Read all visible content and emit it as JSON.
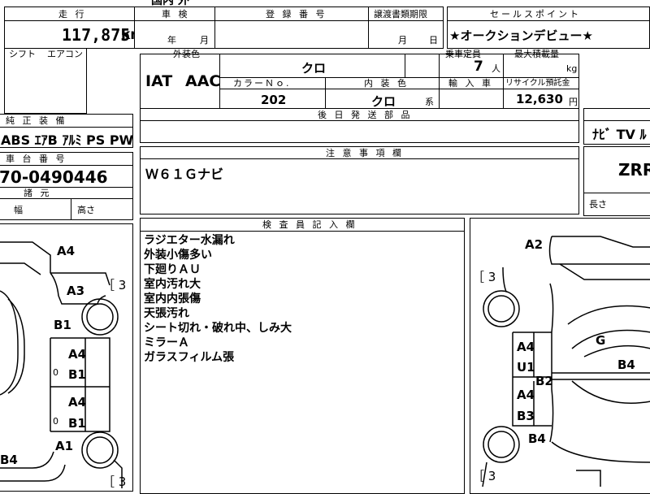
{
  "header": {
    "top_cut_text": "国内 外",
    "mileage_label": "走 行",
    "mileage_value": "117,875",
    "mileage_unit": "km",
    "shaken_label": "車 検",
    "shaken_year_unit": "年",
    "shaken_month_unit": "月",
    "reg_label": "登 録 番 号",
    "transfer_label": "譲渡書類期限",
    "transfer_month_unit": "月",
    "transfer_day_unit": "日",
    "sales_point_label": "セールスポイント",
    "sales_point_value": "★オークションデビュー★"
  },
  "specs": {
    "shift_label": "シフト",
    "aircon_label": "エアコン",
    "shift_value": "IAT",
    "aircon_value": "AAC",
    "color_cut_label": "外装色",
    "color_value": "クロ",
    "capacity_cut_label": "乗車定員",
    "capacity_value": "7",
    "capacity_unit": "人",
    "maxload_cut_label": "最大積載量",
    "maxload_unit": "kg",
    "color_no_label": "カラーＮｏ.",
    "color_no_value": "202",
    "interior_label": "内 装 色",
    "interior_value": "クロ",
    "interior_unit": "系",
    "import_label": "輸 入 車",
    "recycle_label": "リサイクル預託金",
    "recycle_value": "12,630",
    "recycle_unit": "円",
    "later_parts_label": "後 日 発 送 部 品"
  },
  "equipment": {
    "label": "純 正 装 備",
    "value": "ABS ｴｱB ｱﾙﾐ PS PW",
    "right_value": "ﾅﾋﾞ TV ﾙ"
  },
  "chassis": {
    "label": "車 台 番 号",
    "value": "70-0490446",
    "specs_label": "諸 元",
    "width_label": "幅",
    "height_label": "高さ",
    "length_label": "長さ",
    "model_value": "ZRR"
  },
  "caution": {
    "label": "注 意 事 項 欄",
    "value": "Ｗ６１Ｇナビ"
  },
  "inspector": {
    "label": "検 査 員 記 入 欄",
    "notes": [
      "ラジエター水漏れ",
      "外装小傷多い",
      "下廻りＡＵ",
      "室内汚れ大",
      "室内内張傷",
      "天張汚れ",
      "シート切れ・破れ中、しみ大",
      "ミラーＡ",
      "ガラスフィルム張"
    ]
  },
  "diagram_left": {
    "marks": [
      "A4",
      "A3",
      "B1",
      "A4",
      "B1",
      "A4",
      "B1",
      "A1",
      "B4"
    ],
    "small": [
      "0",
      "0"
    ],
    "brackets": [
      "［ 3",
      "［ 3"
    ]
  },
  "diagram_right": {
    "marks": [
      "A2",
      "A4",
      "U1",
      "B2",
      "A4",
      "B3",
      "B4",
      "G",
      "B4"
    ],
    "brackets": [
      "［ 3",
      "［ 3"
    ]
  }
}
